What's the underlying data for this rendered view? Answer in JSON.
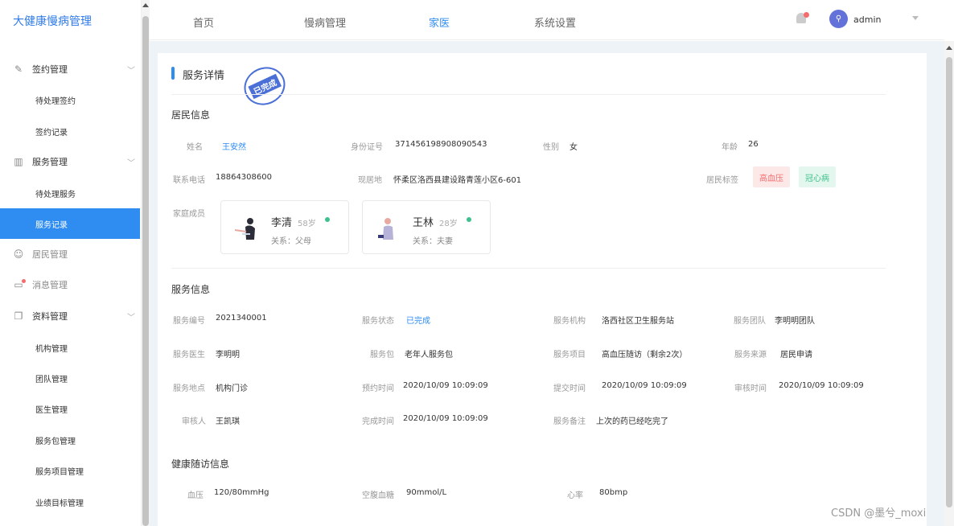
{
  "app": {
    "title": "大健康慢病管理"
  },
  "sidebar": {
    "groups": [
      {
        "label": "签约管理",
        "icon": "edit-icon",
        "items": [
          "待处理签约",
          "签约记录"
        ]
      },
      {
        "label": "服务管理",
        "icon": "service-icon",
        "items": [
          "待处理服务",
          "服务记录"
        ]
      },
      {
        "label": "居民管理",
        "icon": "resident-icon"
      },
      {
        "label": "消息管理",
        "icon": "message-icon"
      },
      {
        "label": "资料管理",
        "icon": "files-icon",
        "items": [
          "机构管理",
          "团队管理",
          "医生管理",
          "服务包管理",
          "服务项目管理",
          "业绩目标管理"
        ]
      }
    ],
    "active_item": "服务记录"
  },
  "topnav": {
    "tabs": [
      "首页",
      "慢病管理",
      "家医",
      "系统设置"
    ],
    "active_tab": "家医",
    "username": "admin"
  },
  "page": {
    "title": "服务详情",
    "stamp": "已完成",
    "resident": {
      "section": "居民信息",
      "name_label": "姓名",
      "name": "王安然",
      "id_label": "身份证号",
      "id_number": "371456198908090543",
      "gender_label": "性别",
      "gender": "女",
      "age_label": "年龄",
      "age": "26",
      "phone_label": "联系电话",
      "phone": "18864308600",
      "address_label": "现居地",
      "address": "怀柔区洛西县建设路青莲小区6-601",
      "tags_label": "居民标签",
      "tags": [
        "高血压",
        "冠心病"
      ],
      "family_label": "家庭成员",
      "family": [
        {
          "name": "李清",
          "age": "58岁",
          "relation": "关系：父母"
        },
        {
          "name": "王林",
          "age": "28岁",
          "relation": "关系：夫妻"
        }
      ]
    },
    "service": {
      "section": "服务信息",
      "fields": [
        {
          "label": "服务编号",
          "value": "2021340001"
        },
        {
          "label": "服务状态",
          "value": "已完成"
        },
        {
          "label": "服务机构",
          "value": "洛西社区卫生服务站"
        },
        {
          "label": "服务团队",
          "value": "李明明团队"
        },
        {
          "label": "服务医生",
          "value": "李明明"
        },
        {
          "label": "服务包",
          "value": "老年人服务包"
        },
        {
          "label": "服务项目",
          "value": "高血压随访（剩余2次）"
        },
        {
          "label": "服务来源",
          "value": "居民申请"
        },
        {
          "label": "服务地点",
          "value": "机构门诊"
        },
        {
          "label": "预约时间",
          "value": "2020/10/09 10:09:09"
        },
        {
          "label": "提交时间",
          "value": "2020/10/09 10:09:09"
        },
        {
          "label": "审核时间",
          "value": "2020/10/09 10:09:09"
        },
        {
          "label": "审核人",
          "value": "王凯琪"
        },
        {
          "label": "完成时间",
          "value": "2020/10/09 10:09:09"
        },
        {
          "label": "服务备注",
          "value": "上次的药已经吃完了"
        }
      ]
    },
    "health": {
      "section": "健康随访信息",
      "fields": [
        {
          "label": "血压",
          "value": "120/80mmHg"
        },
        {
          "label": "空腹血糖",
          "value": "90mmol/L"
        },
        {
          "label": "心率",
          "value": "80bmp"
        }
      ]
    }
  },
  "watermark": "CSDN @墨兮_moxi",
  "colors": {
    "accent": "#2f8cf0",
    "tag_red": "#f56c6c",
    "tag_green": "#3fbf8a"
  }
}
